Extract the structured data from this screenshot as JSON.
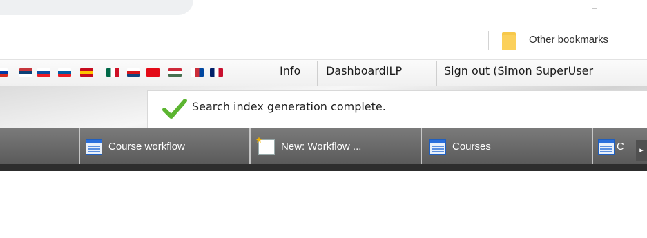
{
  "browser": {
    "bookmarks_bar": {
      "other_bookmarks_label": "Other bookmarks"
    }
  },
  "menubar": {
    "flags": [
      {
        "name": "russia-flag",
        "colors": [
          "#ffffff",
          "#0039a6",
          "#d52b1e"
        ]
      },
      {
        "name": "serbia-flag",
        "colors": [
          "#c6363c",
          "#0c4076",
          "#ffffff"
        ]
      },
      {
        "name": "slovakia-flag",
        "colors": [
          "#ffffff",
          "#0b4ea2",
          "#ee1c25"
        ]
      },
      {
        "name": "slovenia-flag",
        "colors": [
          "#ffffff",
          "#005da4",
          "#ed1c24"
        ]
      },
      {
        "name": "spain-flag",
        "colors": [
          "#c60b1e",
          "#ffc400",
          "#c60b1e"
        ]
      },
      {
        "name": "mexico-flag",
        "colors": [
          "#006847",
          "#ffffff",
          "#ce1126"
        ]
      },
      {
        "name": "czech-flag",
        "colors": [
          "#ffffff",
          "#d7141a",
          "#11457e"
        ]
      },
      {
        "name": "turkey-flag",
        "colors": [
          "#e30a17"
        ]
      },
      {
        "name": "hungary-flag",
        "colors": [
          "#ce2939",
          "#ffffff",
          "#477050"
        ]
      },
      {
        "name": "korea-flag",
        "colors": [
          "#ffffff",
          "#cd2e3a",
          "#0047a0"
        ]
      },
      {
        "name": "uk-flag",
        "colors": [
          "#012169",
          "#ffffff",
          "#c8102e"
        ]
      }
    ],
    "info_label": "Info",
    "dashboard_label": "DashboardILP",
    "signout_label": "Sign out (Simon SuperUser"
  },
  "notification": {
    "message": "Search index generation complete.",
    "icon": "checkmark-icon",
    "color": "#5cb531"
  },
  "tabs": [
    {
      "label": "Course workflow",
      "icon": "grid-icon"
    },
    {
      "label": "New: Workflow ...",
      "icon": "new-document-icon"
    },
    {
      "label": "Courses",
      "icon": "grid-icon"
    },
    {
      "label": "C",
      "icon": "grid-icon"
    }
  ],
  "colors": {
    "tabbar": "#6a6a6a",
    "tab_text": "#ffffff",
    "bookmark_folder": "#f7c84a"
  }
}
